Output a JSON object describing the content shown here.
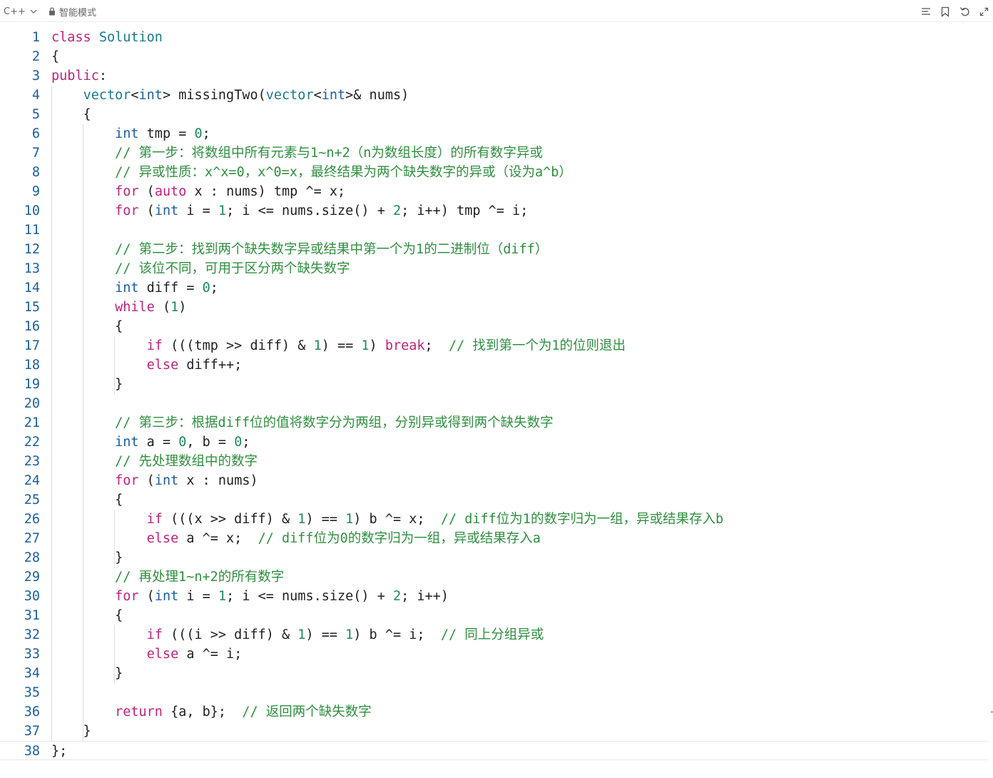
{
  "toolbar": {
    "language": "C++",
    "mode": "智能模式",
    "icons": [
      "list-icon",
      "bookmark-icon",
      "undo-icon",
      "expand-icon"
    ]
  },
  "editor": {
    "lines": [
      {
        "n": "1",
        "t": "class Solution"
      },
      {
        "n": "2",
        "t": "{"
      },
      {
        "n": "3",
        "t": "public:"
      },
      {
        "n": "4",
        "t": "    vector<int> missingTwo(vector<int>& nums)"
      },
      {
        "n": "5",
        "t": "    {"
      },
      {
        "n": "6",
        "t": "        int tmp = 0;"
      },
      {
        "n": "7",
        "t": "        // 第一步：将数组中所有元素与1~n+2（n为数组长度）的所有数字异或"
      },
      {
        "n": "8",
        "t": "        // 异或性质：x^x=0，x^0=x，最终结果为两个缺失数字的异或（设为a^b）"
      },
      {
        "n": "9",
        "t": "        for (auto x : nums) tmp ^= x;"
      },
      {
        "n": "10",
        "t": "        for (int i = 1; i <= nums.size() + 2; i++) tmp ^= i;"
      },
      {
        "n": "11",
        "t": ""
      },
      {
        "n": "12",
        "t": "        // 第二步：找到两个缺失数字异或结果中第一个为1的二进制位（diff）"
      },
      {
        "n": "13",
        "t": "        // 该位不同，可用于区分两个缺失数字"
      },
      {
        "n": "14",
        "t": "        int diff = 0;"
      },
      {
        "n": "15",
        "t": "        while (1)"
      },
      {
        "n": "16",
        "t": "        {"
      },
      {
        "n": "17",
        "t": "            if (((tmp >> diff) & 1) == 1) break;  // 找到第一个为1的位则退出"
      },
      {
        "n": "18",
        "t": "            else diff++;"
      },
      {
        "n": "19",
        "t": "        }"
      },
      {
        "n": "20",
        "t": ""
      },
      {
        "n": "21",
        "t": "        // 第三步：根据diff位的值将数字分为两组，分别异或得到两个缺失数字"
      },
      {
        "n": "22",
        "t": "        int a = 0, b = 0;"
      },
      {
        "n": "23",
        "t": "        // 先处理数组中的数字"
      },
      {
        "n": "24",
        "t": "        for (int x : nums)"
      },
      {
        "n": "25",
        "t": "        {"
      },
      {
        "n": "26",
        "t": "            if (((x >> diff) & 1) == 1) b ^= x;  // diff位为1的数字归为一组，异或结果存入b"
      },
      {
        "n": "27",
        "t": "            else a ^= x;  // diff位为0的数字归为一组，异或结果存入a"
      },
      {
        "n": "28",
        "t": "        }"
      },
      {
        "n": "29",
        "t": "        // 再处理1~n+2的所有数字"
      },
      {
        "n": "30",
        "t": "        for (int i = 1; i <= nums.size() + 2; i++)"
      },
      {
        "n": "31",
        "t": "        {"
      },
      {
        "n": "32",
        "t": "            if (((i >> diff) & 1) == 1) b ^= i;  // 同上分组异或"
      },
      {
        "n": "33",
        "t": "            else a ^= i;"
      },
      {
        "n": "34",
        "t": "        }"
      },
      {
        "n": "35",
        "t": ""
      },
      {
        "n": "36",
        "t": "        return {a, b};  // 返回两个缺失数字"
      },
      {
        "n": "37",
        "t": "    }"
      },
      {
        "n": "38",
        "t": "};"
      }
    ],
    "current_line": "38"
  },
  "colors": {
    "keyword": "#c1227c",
    "type": "#1c5fa6",
    "number": "#1c8a5a",
    "comment": "#2f8f3f",
    "line_number": "#1a5f9e"
  }
}
